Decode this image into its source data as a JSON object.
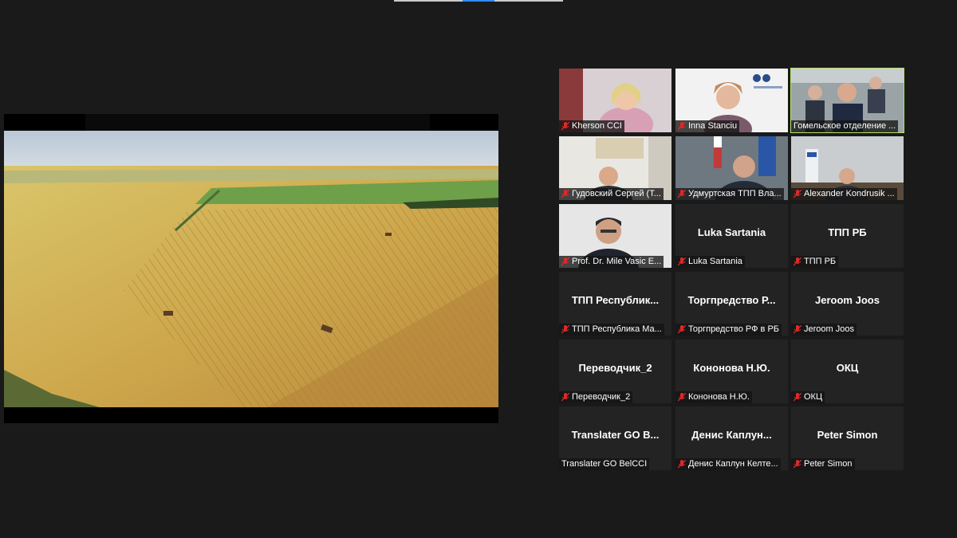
{
  "share": {
    "title": ""
  },
  "participants": [
    {
      "name": "Kherson CCI",
      "video": true,
      "muted": true
    },
    {
      "name": "Inna Stanciu",
      "video": true,
      "muted": true
    },
    {
      "name": "Гомельское отделение ...",
      "video": true,
      "muted": false,
      "active": true
    },
    {
      "name": "Гудовский Сергей (Т...",
      "video": true,
      "muted": true
    },
    {
      "name": "Удмуртская ТПП  Вла...",
      "video": true,
      "muted": true
    },
    {
      "name": "Alexander Kondrusik ...",
      "video": true,
      "muted": true
    },
    {
      "name": "Prof. Dr. Mile Vasic  E...",
      "video": true,
      "muted": true
    },
    {
      "display": "Luka Sartania",
      "name": "Luka Sartania",
      "video": false,
      "muted": true
    },
    {
      "display": "ТПП РБ",
      "name": "ТПП РБ",
      "video": false,
      "muted": true
    },
    {
      "display": "ТПП  Республик...",
      "name": "ТПП Республика Ма...",
      "video": false,
      "muted": true
    },
    {
      "display": "Торгпредство  Р...",
      "name": "Торгпредство РФ в РБ",
      "video": false,
      "muted": true
    },
    {
      "display": "Jeroom Joos",
      "name": "Jeroom Joos",
      "video": false,
      "muted": true
    },
    {
      "display": "Переводчик_2",
      "name": "Переводчик_2",
      "video": false,
      "muted": true
    },
    {
      "display": "Кононова Н.Ю.",
      "name": "Кононова Н.Ю.",
      "video": false,
      "muted": true
    },
    {
      "display": "ОКЦ",
      "name": "ОКЦ",
      "video": false,
      "muted": true
    },
    {
      "display": "Translater GO B...",
      "name": "Translater GO BelCCI",
      "video": false,
      "muted": false
    },
    {
      "display": "Денис  Каплун...",
      "name": "Денис Каплун Келте...",
      "video": false,
      "muted": true
    },
    {
      "display": "Peter Simon",
      "name": "Peter Simon",
      "video": false,
      "muted": true
    }
  ],
  "colors": {
    "muted_icon": "#e02828",
    "active_border": "#b7e36a",
    "tile_bg": "#232323"
  }
}
